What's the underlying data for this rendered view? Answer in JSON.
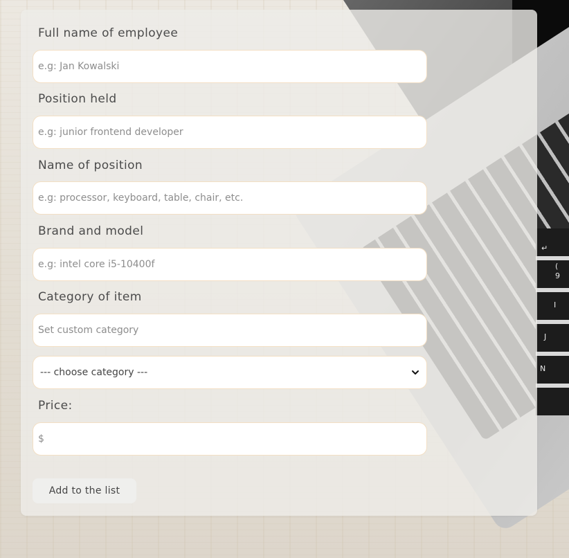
{
  "form": {
    "fields": [
      {
        "label": "Full name of employee",
        "placeholder": "e.g: Jan Kowalski",
        "value": ""
      },
      {
        "label": "Position held",
        "placeholder": "e.g: junior frontend developer",
        "value": ""
      },
      {
        "label": "Name of position",
        "placeholder": "e.g: processor, keyboard, table, chair, etc.",
        "value": ""
      },
      {
        "label": "Brand and model",
        "placeholder": "e.g: intel core i5-10400f",
        "value": ""
      },
      {
        "label": "Category of item",
        "placeholder": "Set custom category",
        "value": ""
      }
    ],
    "category_select": {
      "selected": "--- choose category ---"
    },
    "price": {
      "label": "Price:",
      "placeholder": "$",
      "value": ""
    },
    "submit_label": "Add to the list"
  },
  "background": {
    "visible_keys": [
      "↵",
      "(",
      "9",
      "I",
      "J",
      "N"
    ]
  },
  "colors": {
    "panel": "#eeece8",
    "field_border": "#f3dfc4",
    "label_text": "#4b4b4b",
    "placeholder_text": "#8d8d8d"
  },
  "icons": {
    "select_arrow": "chevron-down-icon"
  }
}
